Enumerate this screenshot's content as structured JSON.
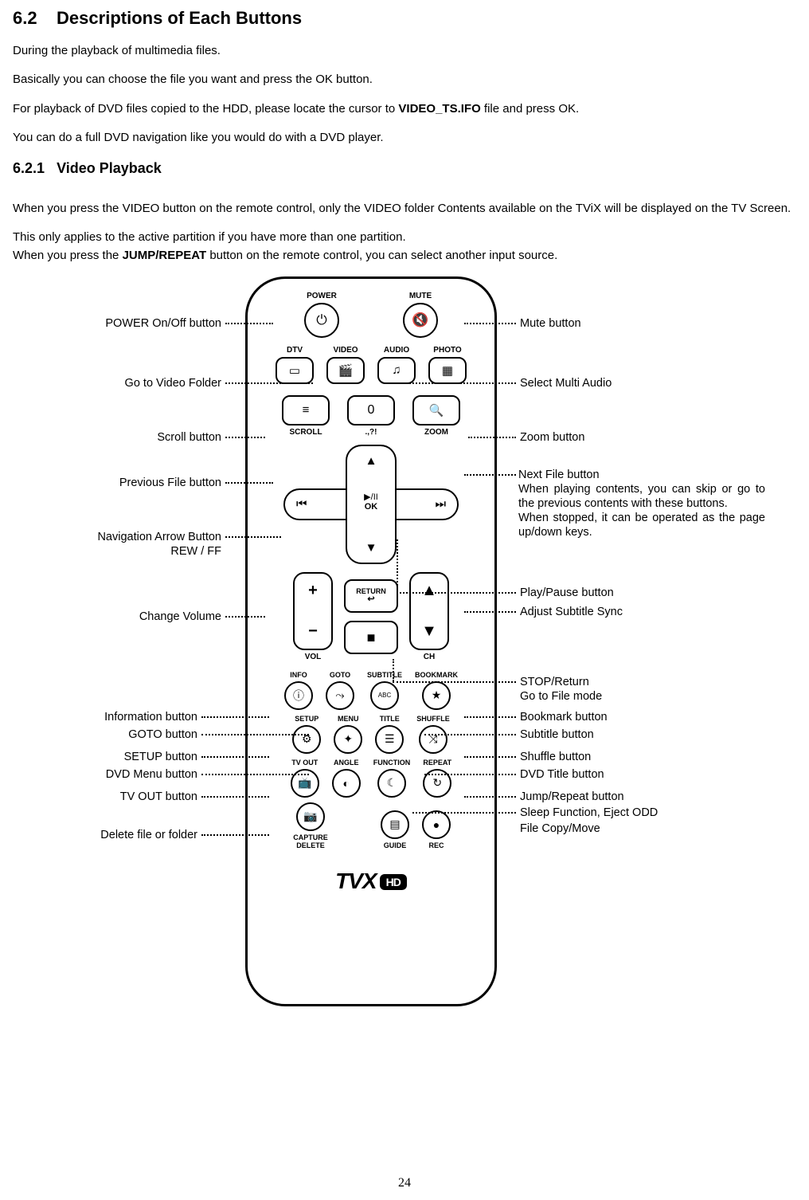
{
  "section": {
    "num": "6.2",
    "title": "Descriptions of Each Buttons",
    "p1": "During the playback of multimedia files.",
    "p2": "Basically you can choose the file you want and press the OK button.",
    "p3_a": "For playback of DVD files copied to the HDD, please locate the cursor to ",
    "p3_bold": "VIDEO_TS.IFO",
    "p3_b": " file and press OK.",
    "p4": "You can do a full DVD navigation like you would do with a DVD player.",
    "sub_num": "6.2.1",
    "sub_title": "Video Playback",
    "p5": "When you press the VIDEO button on the remote control, only the VIDEO folder Contents available on the TViX will be displayed on the TV Screen.",
    "p6": "This only applies to the active partition if you have more than one partition.",
    "p7_a": "When you press the ",
    "p7_bold": "JUMP/REPEAT",
    "p7_b": " button on the remote control, you can select another input source."
  },
  "remote": {
    "power_lbl": "POWER",
    "mute_lbl": "MUTE",
    "dtv": "DTV",
    "video": "VIDEO",
    "audio": "AUDIO",
    "photo": "PHOTO",
    "scroll": "SCROLL",
    "numsym": ".,?!",
    "zoom": "ZOOM",
    "zero": "0",
    "play_ok": "▶/II",
    "ok": "OK",
    "vol": "VOL",
    "return": "RETURN",
    "ch": "CH",
    "info": "INFO",
    "goto": "GOTO",
    "subtitle": "SUBTITLE",
    "bookmark": "BOOKMARK",
    "setup": "SETUP",
    "menu": "MENU",
    "title": "TITLE",
    "shuffle": "SHUFFLE",
    "tvout": "TV OUT",
    "angle": "ANGLE",
    "func": "FUNCTION",
    "repeat": "REPEAT",
    "capdel": "CAPTURE\nDELETE",
    "guide": "GUIDE",
    "rec": "REC",
    "logo": "TVX",
    "hd": "HD"
  },
  "ann_left": {
    "power": "POWER On/Off button",
    "video": "Go to Video Folder",
    "scroll": "Scroll button",
    "prev": "Previous File button",
    "nav1": "Navigation Arrow Button",
    "nav2": "REW / FF",
    "volume": "Change Volume",
    "info": "Information button",
    "goto": "GOTO button",
    "setup": "SETUP button",
    "dvdmenu": "DVD Menu button",
    "tvout": "TV OUT button",
    "delete": "Delete file or folder"
  },
  "ann_right": {
    "mute": "Mute button",
    "multi": "Select Multi Audio",
    "zoom": "Zoom button",
    "next": "Next File button\nWhen playing contents, you can skip or go to the previous contents with these buttons.\nWhen stopped, it can be operated as the page up/down keys.",
    "play": "Play/Pause button",
    "adjsub": "Adjust Subtitle Sync",
    "stop": "STOP/Return\nGo to File mode",
    "bookmark": "Bookmark button",
    "subtitle": "Subtitle button",
    "shuffle": "Shuffle button",
    "dvdtitle": "DVD Title button",
    "jump": "Jump/Repeat button",
    "sleep": "Sleep Function, Eject ODD",
    "copy": "File Copy/Move"
  },
  "page_number": "24"
}
